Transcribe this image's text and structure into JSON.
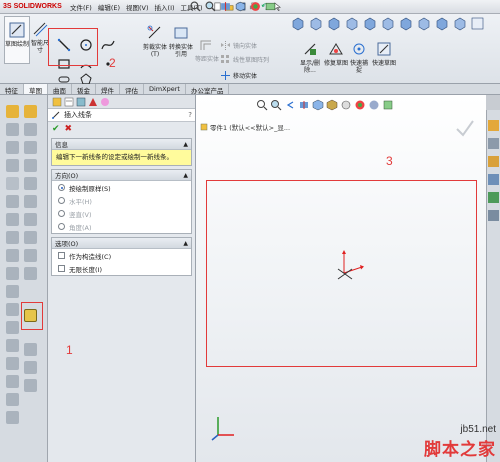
{
  "title_bar": {
    "brand": "SOLIDWORKS",
    "menu": [
      "文件(F)",
      "编辑(E)",
      "视图(V)",
      "插入(I)",
      "工具(T)"
    ]
  },
  "ribbon": {
    "sketch_button": "草图绘制",
    "smart_dim": "智能尺寸",
    "trim": "剪裁实体(T)",
    "convert": "转换实体引用",
    "offset": "等距实体",
    "mirror": "镜向实体",
    "linear_pattern": "线性草图阵列",
    "move": "移动实体",
    "display_delete": "显示/删除...",
    "repair": "修复草图",
    "quick_snap": "快速捕捉",
    "rapid_sketch": "快速草图"
  },
  "tabs": [
    "特征",
    "草图",
    "曲面",
    "钣金",
    "焊件",
    "评估",
    "DimXpert",
    "办公室产品"
  ],
  "active_tab": "草图",
  "property_manager": {
    "title": "插入线条",
    "help": "?",
    "info_header": "信息",
    "info_text": "编辑下一新线条的设定或绘制一新线条。",
    "direction_header": "方向(O)",
    "direction_options": [
      {
        "label": "按绘制原样(S)",
        "selected": true,
        "enabled": true
      },
      {
        "label": "水平(H)",
        "selected": false,
        "enabled": false
      },
      {
        "label": "竖直(V)",
        "selected": false,
        "enabled": false
      },
      {
        "label": "角度(A)",
        "selected": false,
        "enabled": false
      }
    ],
    "options_header": "选项(O)",
    "options": [
      {
        "label": "作为构造线(C)",
        "checked": false
      },
      {
        "label": "无限长度(I)",
        "checked": false
      }
    ]
  },
  "graphics": {
    "tree_label": "零件1 (默认<<默认>_显..."
  },
  "annotations": {
    "label_1": "1",
    "label_2": "2",
    "label_3": "3"
  },
  "watermark": {
    "url": "jb51.net",
    "name": "脚本之家"
  },
  "colors": {
    "annotation_red": "#e23a3a",
    "info_yellow": "#fffb9c",
    "ok_green": "#2a9a2a"
  }
}
